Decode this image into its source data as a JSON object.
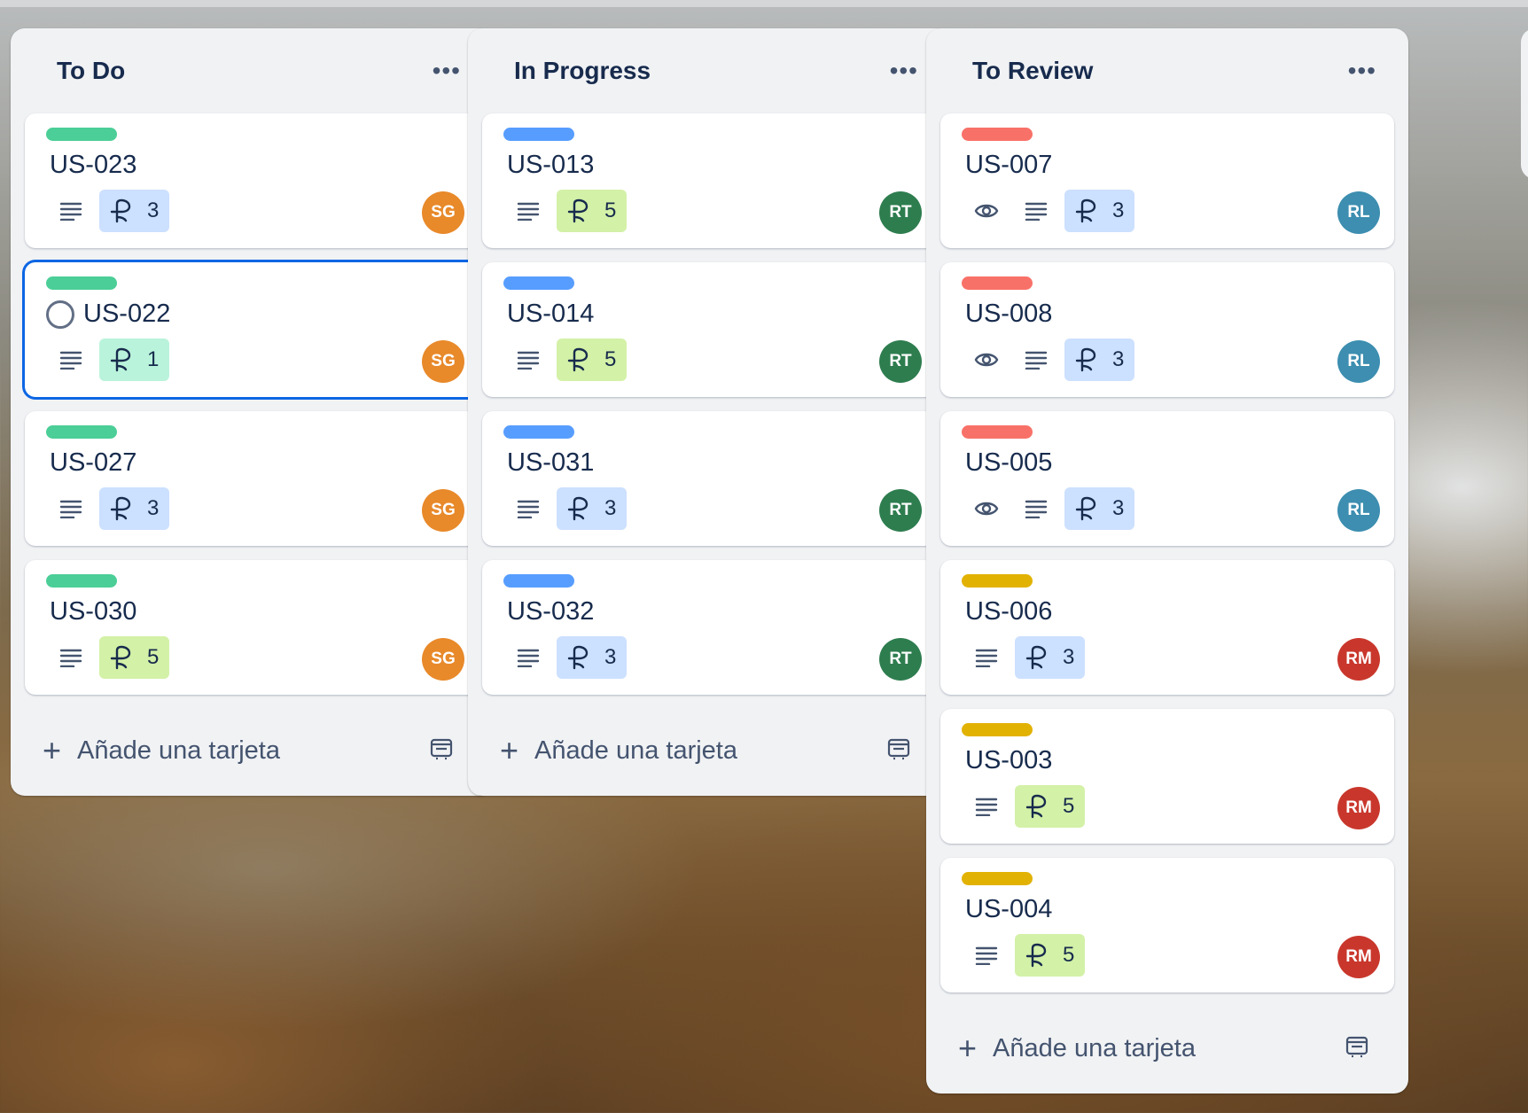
{
  "colors": {
    "green_label": "#4bce97",
    "blue_label": "#579dff",
    "red_label": "#f87168",
    "yellow_label": "#e2b203",
    "points_blue": "#cce0ff",
    "points_lime": "#d3f1a7",
    "points_teal": "#baf3db"
  },
  "add_card_label": "Añade una tarjeta",
  "lists": [
    {
      "title": "To Do",
      "cards": [
        {
          "id": "US-023",
          "label_color": "green",
          "points": "3",
          "points_color": "blue",
          "avatar": "SG",
          "avatar_color": "#e8892a"
        },
        {
          "id": "US-022",
          "label_color": "green",
          "points": "1",
          "points_color": "teal",
          "avatar": "SG",
          "avatar_color": "#e8892a",
          "selected": true
        },
        {
          "id": "US-027",
          "label_color": "green",
          "points": "3",
          "points_color": "blue",
          "avatar": "SG",
          "avatar_color": "#e8892a"
        },
        {
          "id": "US-030",
          "label_color": "green",
          "points": "5",
          "points_color": "lime",
          "avatar": "SG",
          "avatar_color": "#e8892a"
        }
      ]
    },
    {
      "title": "In Progress",
      "cards": [
        {
          "id": "US-013",
          "label_color": "blue",
          "points": "5",
          "points_color": "lime",
          "avatar": "RT",
          "avatar_color": "#2e7d4f"
        },
        {
          "id": "US-014",
          "label_color": "blue",
          "points": "5",
          "points_color": "lime",
          "avatar": "RT",
          "avatar_color": "#2e7d4f"
        },
        {
          "id": "US-031",
          "label_color": "blue",
          "points": "3",
          "points_color": "blue",
          "avatar": "RT",
          "avatar_color": "#2e7d4f"
        },
        {
          "id": "US-032",
          "label_color": "blue",
          "points": "3",
          "points_color": "blue",
          "avatar": "RT",
          "avatar_color": "#2e7d4f"
        }
      ]
    },
    {
      "title": "To Review",
      "cards": [
        {
          "id": "US-007",
          "label_color": "red",
          "points": "3",
          "points_color": "blue",
          "avatar": "RL",
          "avatar_color": "#3d8eb0",
          "watch": true
        },
        {
          "id": "US-008",
          "label_color": "red",
          "points": "3",
          "points_color": "blue",
          "avatar": "RL",
          "avatar_color": "#3d8eb0",
          "watch": true
        },
        {
          "id": "US-005",
          "label_color": "red",
          "points": "3",
          "points_color": "blue",
          "avatar": "RL",
          "avatar_color": "#3d8eb0",
          "watch": true
        },
        {
          "id": "US-006",
          "label_color": "yellow",
          "points": "3",
          "points_color": "blue",
          "avatar": "RM",
          "avatar_color": "#c9372c"
        },
        {
          "id": "US-003",
          "label_color": "yellow",
          "points": "5",
          "points_color": "lime",
          "avatar": "RM",
          "avatar_color": "#c9372c"
        },
        {
          "id": "US-004",
          "label_color": "yellow",
          "points": "5",
          "points_color": "lime",
          "avatar": "RM",
          "avatar_color": "#c9372c"
        }
      ]
    }
  ]
}
